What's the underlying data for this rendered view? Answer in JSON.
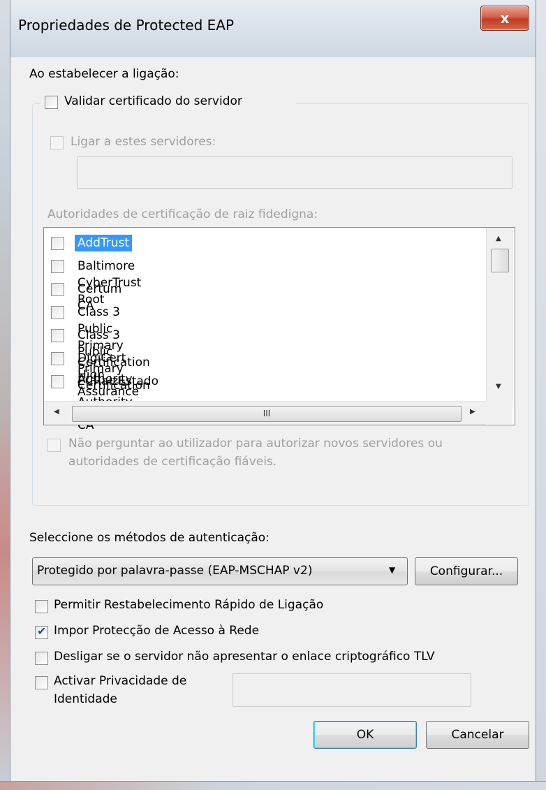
{
  "window": {
    "title": "Propriedades de Protected EAP",
    "close_label": "x"
  },
  "connection": {
    "heading": "Ao estabelecer a ligação:",
    "validate_cert_label": "Validar certificado do servidor",
    "validate_cert_checked": false,
    "connect_servers_label": "Ligar a estes servidores:",
    "servers_value": "",
    "trusted_roots_label": "Autoridades de certificação de raiz fidedigna:",
    "ca_list": [
      {
        "label": "AddTrust External CA Root",
        "checked": false,
        "selected": true
      },
      {
        "label": "Baltimore CyberTrust Root",
        "checked": false,
        "selected": false
      },
      {
        "label": "Certum CA",
        "checked": false,
        "selected": false
      },
      {
        "label": "Class 3 Public Primary Certification Authority",
        "checked": false,
        "selected": false
      },
      {
        "label": "Class 3 Public Primary Certification Authority",
        "checked": false,
        "selected": false
      },
      {
        "label": "DigiCert High Assurance EV Root CA",
        "checked": false,
        "selected": false
      },
      {
        "label": "ECRaizEstado",
        "checked": false,
        "selected": false
      }
    ],
    "scroll_up_arrow": "▲",
    "scroll_down_arrow": "▼",
    "scroll_left_arrow": "◀",
    "scroll_right_arrow": "▶",
    "hscroll_grip": "III",
    "dont_prompt_line1": "Não perguntar ao utilizador para autorizar novos servidores ou",
    "dont_prompt_line2": "autoridades de certificação fiáveis."
  },
  "auth": {
    "heading": "Seleccione os métodos de autenticação:",
    "method_selected": "Protegido por palavra-passe (EAP-MSCHAP v2)",
    "configure_button": "Configurar..."
  },
  "options": {
    "fast_reconnect_label": "Permitir Restabelecimento Rápido de Ligação",
    "fast_reconnect_checked": false,
    "nap_label": "Impor Protecção de Acesso à Rede",
    "nap_checked": true,
    "disconnect_tlv_label": "Desligar se o servidor não apresentar o enlace criptográfico TLV",
    "disconnect_tlv_checked": false,
    "identity_privacy_line1": "Activar Privacidade de",
    "identity_privacy_line2": "Identidade",
    "identity_privacy_checked": false,
    "identity_value": ""
  },
  "buttons": {
    "ok": "OK",
    "cancel": "Cancelar"
  }
}
